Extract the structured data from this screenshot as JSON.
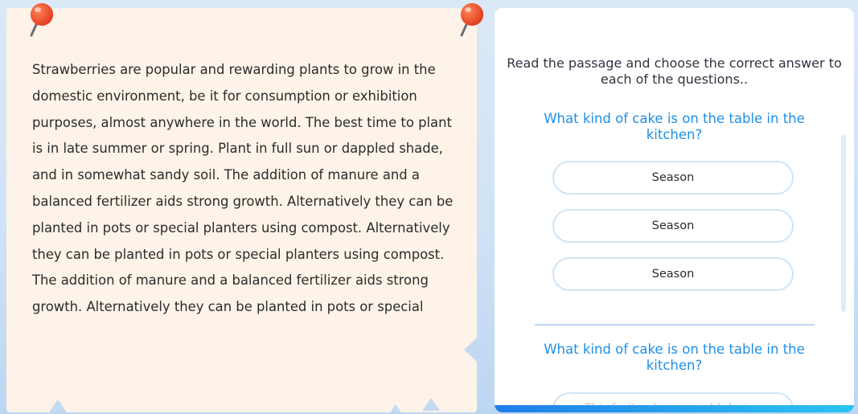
{
  "passage": {
    "paragraphs": [
      "Strawberries are popular and rewarding plants to grow in the domestic environment, be it for consumption or exhibition purposes, almost anywhere in the world. The best time to plant is in late summer or spring. Plant in full sun or dappled shade, and in somewhat sandy soil. The addition of manure and a balanced fertilizer aids strong growth. Alternatively they can be planted in pots or special planters using compost. Alternatively they can be planted in pots or special planters using compost.",
      "The addition of manure and a balanced fertilizer aids strong growth. Alternatively they can be planted in pots or special"
    ]
  },
  "quiz": {
    "instructions": "Read the passage and choose the correct answer to each of the questions..",
    "questions": [
      {
        "text": "What kind of cake is on the table in the kitchen?",
        "options": [
          "Season",
          "Season",
          "Season"
        ]
      },
      {
        "text": "What kind of cake is on the table in the kitchen?",
        "options": [
          "This fruit cake was sold during"
        ]
      }
    ]
  },
  "colors": {
    "accent": "#1f8fe6",
    "passage_bg": "#fdf3e8",
    "page_bg": "#cfe2f6",
    "option_border": "#cfe5f6",
    "pin": "#f4542b"
  },
  "icons": {
    "pin_left": "push-pin-icon",
    "pin_right": "push-pin-icon"
  }
}
